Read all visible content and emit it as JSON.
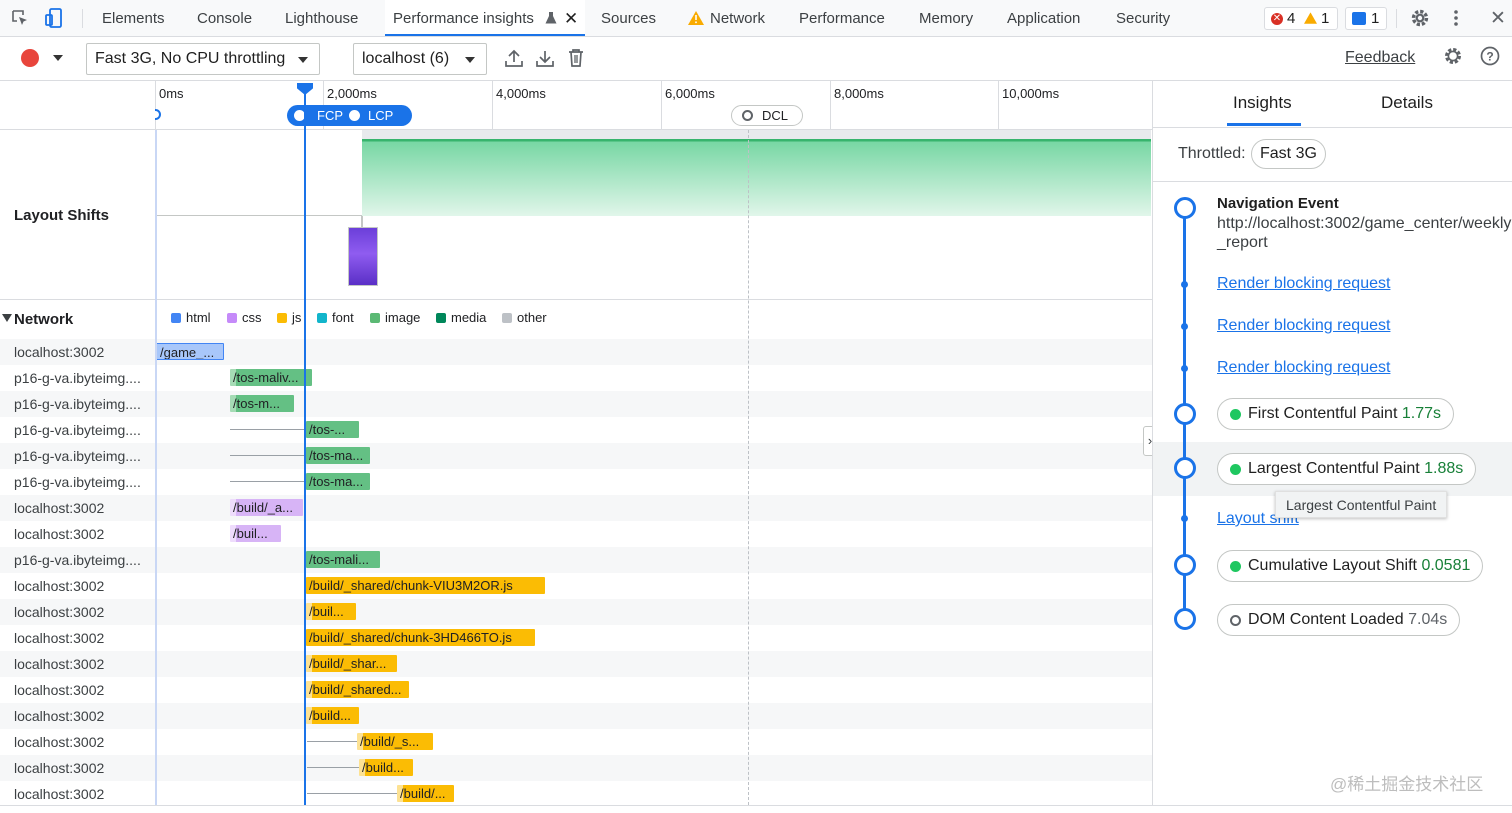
{
  "tabs": [
    "Elements",
    "Console",
    "Lighthouse",
    "Performance insights",
    "Sources",
    "Network",
    "Performance",
    "Memory",
    "Application",
    "Security"
  ],
  "counts": {
    "errors": "4",
    "warnings": "1",
    "messages": "1"
  },
  "toolbar": {
    "throttle": "Fast 3G, No CPU throttling",
    "recording": "localhost (6)",
    "feedback": "Feedback"
  },
  "ruler": {
    "ticks": [
      "0ms",
      "2,000ms",
      "4,000ms",
      "6,000ms",
      "8,000ms",
      "10,000ms"
    ],
    "fcp": "FCP",
    "lcp": "LCP",
    "dcl": "DCL"
  },
  "tracks": {
    "layout_shifts": "Layout Shifts",
    "network": "Network"
  },
  "legend": [
    {
      "label": "html",
      "color": "#4285f4"
    },
    {
      "label": "css",
      "color": "#c58af9"
    },
    {
      "label": "js",
      "color": "#fbbc04"
    },
    {
      "label": "font",
      "color": "#12b5cb"
    },
    {
      "label": "image",
      "color": "#5bb974"
    },
    {
      "label": "media",
      "color": "#00875a"
    },
    {
      "label": "other",
      "color": "#bdc1c6"
    }
  ],
  "requests": [
    {
      "host": "localhost:3002",
      "label": "/game_...",
      "type": "html"
    },
    {
      "host": "p16-g-va.ibyteimg....",
      "label": "/tos-maliv...",
      "type": "img"
    },
    {
      "host": "p16-g-va.ibyteimg....",
      "label": "/tos-m...",
      "type": "img"
    },
    {
      "host": "p16-g-va.ibyteimg....",
      "label": "/tos-...",
      "type": "img"
    },
    {
      "host": "p16-g-va.ibyteimg....",
      "label": "/tos-ma...",
      "type": "img"
    },
    {
      "host": "p16-g-va.ibyteimg....",
      "label": "/tos-ma...",
      "type": "img"
    },
    {
      "host": "localhost:3002",
      "label": "/build/_a...",
      "type": "css"
    },
    {
      "host": "localhost:3002",
      "label": "/buil...",
      "type": "css"
    },
    {
      "host": "p16-g-va.ibyteimg....",
      "label": "/tos-mali...",
      "type": "img"
    },
    {
      "host": "localhost:3002",
      "label": "/build/_shared/chunk-VIU3M2OR.js",
      "type": "js"
    },
    {
      "host": "localhost:3002",
      "label": "/buil...",
      "type": "js"
    },
    {
      "host": "localhost:3002",
      "label": "/build/_shared/chunk-3HD466TO.js",
      "type": "js"
    },
    {
      "host": "localhost:3002",
      "label": "/build/_shar...",
      "type": "js"
    },
    {
      "host": "localhost:3002",
      "label": "/build/_shared...",
      "type": "js"
    },
    {
      "host": "localhost:3002",
      "label": "/build...",
      "type": "js"
    },
    {
      "host": "localhost:3002",
      "label": "/build/_s...",
      "type": "js"
    },
    {
      "host": "localhost:3002",
      "label": "/build...",
      "type": "js"
    },
    {
      "host": "localhost:3002",
      "label": "/build/...",
      "type": "js"
    }
  ],
  "insights": {
    "tabs": [
      "Insights",
      "Details"
    ],
    "throttled_label": "Throttled:",
    "throttled_value": "Fast 3G",
    "nav_title": "Navigation Event",
    "nav_url": "http://localhost:3002/game_center/weekly_report",
    "links": [
      "Render blocking request",
      "Render blocking request",
      "Render blocking request",
      "Layout shift"
    ],
    "fcp": {
      "label": "First Contentful Paint",
      "value": "1.77s"
    },
    "lcp": {
      "label": "Largest Contentful Paint",
      "value": "1.88s"
    },
    "tooltip": "Largest Contentful Paint",
    "cls": {
      "label": "Cumulative Layout Shift",
      "value": "0.0581"
    },
    "dcl": {
      "label": "DOM Content Loaded",
      "value": "7.04s"
    }
  },
  "watermark": "@稀土掘金技术社区"
}
